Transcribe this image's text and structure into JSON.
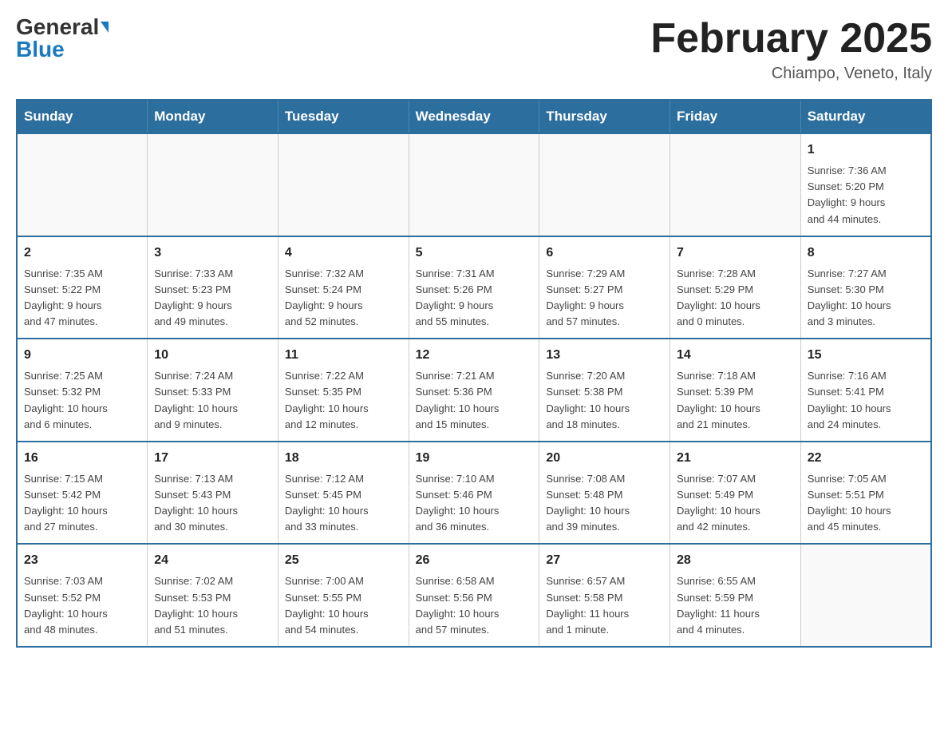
{
  "header": {
    "logo_general": "General",
    "logo_blue": "Blue",
    "month_title": "February 2025",
    "location": "Chiampo, Veneto, Italy"
  },
  "weekdays": [
    "Sunday",
    "Monday",
    "Tuesday",
    "Wednesday",
    "Thursday",
    "Friday",
    "Saturday"
  ],
  "weeks": [
    [
      {
        "day": "",
        "detail": ""
      },
      {
        "day": "",
        "detail": ""
      },
      {
        "day": "",
        "detail": ""
      },
      {
        "day": "",
        "detail": ""
      },
      {
        "day": "",
        "detail": ""
      },
      {
        "day": "",
        "detail": ""
      },
      {
        "day": "1",
        "detail": "Sunrise: 7:36 AM\nSunset: 5:20 PM\nDaylight: 9 hours\nand 44 minutes."
      }
    ],
    [
      {
        "day": "2",
        "detail": "Sunrise: 7:35 AM\nSunset: 5:22 PM\nDaylight: 9 hours\nand 47 minutes."
      },
      {
        "day": "3",
        "detail": "Sunrise: 7:33 AM\nSunset: 5:23 PM\nDaylight: 9 hours\nand 49 minutes."
      },
      {
        "day": "4",
        "detail": "Sunrise: 7:32 AM\nSunset: 5:24 PM\nDaylight: 9 hours\nand 52 minutes."
      },
      {
        "day": "5",
        "detail": "Sunrise: 7:31 AM\nSunset: 5:26 PM\nDaylight: 9 hours\nand 55 minutes."
      },
      {
        "day": "6",
        "detail": "Sunrise: 7:29 AM\nSunset: 5:27 PM\nDaylight: 9 hours\nand 57 minutes."
      },
      {
        "day": "7",
        "detail": "Sunrise: 7:28 AM\nSunset: 5:29 PM\nDaylight: 10 hours\nand 0 minutes."
      },
      {
        "day": "8",
        "detail": "Sunrise: 7:27 AM\nSunset: 5:30 PM\nDaylight: 10 hours\nand 3 minutes."
      }
    ],
    [
      {
        "day": "9",
        "detail": "Sunrise: 7:25 AM\nSunset: 5:32 PM\nDaylight: 10 hours\nand 6 minutes."
      },
      {
        "day": "10",
        "detail": "Sunrise: 7:24 AM\nSunset: 5:33 PM\nDaylight: 10 hours\nand 9 minutes."
      },
      {
        "day": "11",
        "detail": "Sunrise: 7:22 AM\nSunset: 5:35 PM\nDaylight: 10 hours\nand 12 minutes."
      },
      {
        "day": "12",
        "detail": "Sunrise: 7:21 AM\nSunset: 5:36 PM\nDaylight: 10 hours\nand 15 minutes."
      },
      {
        "day": "13",
        "detail": "Sunrise: 7:20 AM\nSunset: 5:38 PM\nDaylight: 10 hours\nand 18 minutes."
      },
      {
        "day": "14",
        "detail": "Sunrise: 7:18 AM\nSunset: 5:39 PM\nDaylight: 10 hours\nand 21 minutes."
      },
      {
        "day": "15",
        "detail": "Sunrise: 7:16 AM\nSunset: 5:41 PM\nDaylight: 10 hours\nand 24 minutes."
      }
    ],
    [
      {
        "day": "16",
        "detail": "Sunrise: 7:15 AM\nSunset: 5:42 PM\nDaylight: 10 hours\nand 27 minutes."
      },
      {
        "day": "17",
        "detail": "Sunrise: 7:13 AM\nSunset: 5:43 PM\nDaylight: 10 hours\nand 30 minutes."
      },
      {
        "day": "18",
        "detail": "Sunrise: 7:12 AM\nSunset: 5:45 PM\nDaylight: 10 hours\nand 33 minutes."
      },
      {
        "day": "19",
        "detail": "Sunrise: 7:10 AM\nSunset: 5:46 PM\nDaylight: 10 hours\nand 36 minutes."
      },
      {
        "day": "20",
        "detail": "Sunrise: 7:08 AM\nSunset: 5:48 PM\nDaylight: 10 hours\nand 39 minutes."
      },
      {
        "day": "21",
        "detail": "Sunrise: 7:07 AM\nSunset: 5:49 PM\nDaylight: 10 hours\nand 42 minutes."
      },
      {
        "day": "22",
        "detail": "Sunrise: 7:05 AM\nSunset: 5:51 PM\nDaylight: 10 hours\nand 45 minutes."
      }
    ],
    [
      {
        "day": "23",
        "detail": "Sunrise: 7:03 AM\nSunset: 5:52 PM\nDaylight: 10 hours\nand 48 minutes."
      },
      {
        "day": "24",
        "detail": "Sunrise: 7:02 AM\nSunset: 5:53 PM\nDaylight: 10 hours\nand 51 minutes."
      },
      {
        "day": "25",
        "detail": "Sunrise: 7:00 AM\nSunset: 5:55 PM\nDaylight: 10 hours\nand 54 minutes."
      },
      {
        "day": "26",
        "detail": "Sunrise: 6:58 AM\nSunset: 5:56 PM\nDaylight: 10 hours\nand 57 minutes."
      },
      {
        "day": "27",
        "detail": "Sunrise: 6:57 AM\nSunset: 5:58 PM\nDaylight: 11 hours\nand 1 minute."
      },
      {
        "day": "28",
        "detail": "Sunrise: 6:55 AM\nSunset: 5:59 PM\nDaylight: 11 hours\nand 4 minutes."
      },
      {
        "day": "",
        "detail": ""
      }
    ]
  ]
}
